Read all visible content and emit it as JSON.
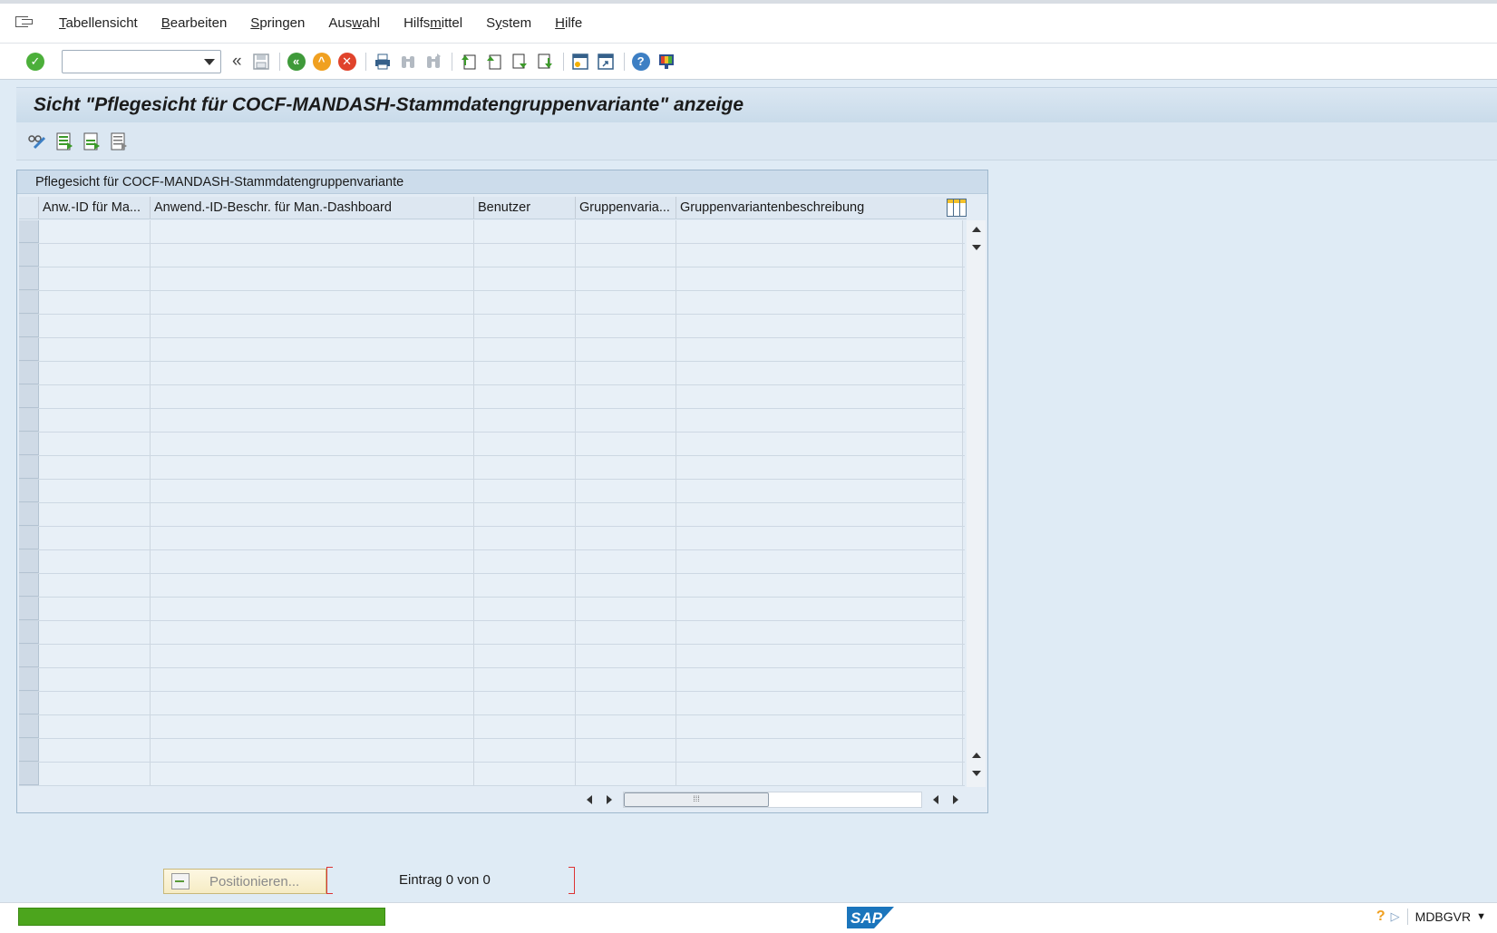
{
  "menu": {
    "items": [
      {
        "pre": "",
        "u": "T",
        "post": "abellensicht"
      },
      {
        "pre": "",
        "u": "B",
        "post": "earbeiten"
      },
      {
        "pre": "",
        "u": "S",
        "post": "pringen"
      },
      {
        "pre": "Aus",
        "u": "w",
        "post": "ahl"
      },
      {
        "pre": "Hilfs",
        "u": "m",
        "post": "ittel"
      },
      {
        "pre": "S",
        "u": "y",
        "post": "stem"
      },
      {
        "pre": "",
        "u": "H",
        "post": "ilfe"
      }
    ]
  },
  "toolbar": {
    "command_field_value": "",
    "back_chevron": "«"
  },
  "title": "Sicht \"Pflegesicht für COCF-MANDASH-Stammdatengruppenvariante\" anzeige",
  "table": {
    "group_title": "Pflegesicht für COCF-MANDASH-Stammdatengruppenvariante",
    "columns": [
      "Anw.-ID für Ma...",
      "Anwend.-ID-Beschr. für Man.-Dashboard",
      "Benutzer",
      "Gruppenvaria...",
      "Gruppenvariantenbeschreibung"
    ],
    "rows": []
  },
  "footer": {
    "position_button": "Positionieren...",
    "entry_text": "Eintrag 0 von 0"
  },
  "status": {
    "system_name": "MDBGVR",
    "progress_color": "#4ca51d"
  },
  "colors": {
    "ok_green": "#4caf3a",
    "back_green": "#3f9a3a",
    "exit_orange": "#f0a020",
    "cancel_red": "#e0432b",
    "title_bg": "#c9dbea"
  }
}
